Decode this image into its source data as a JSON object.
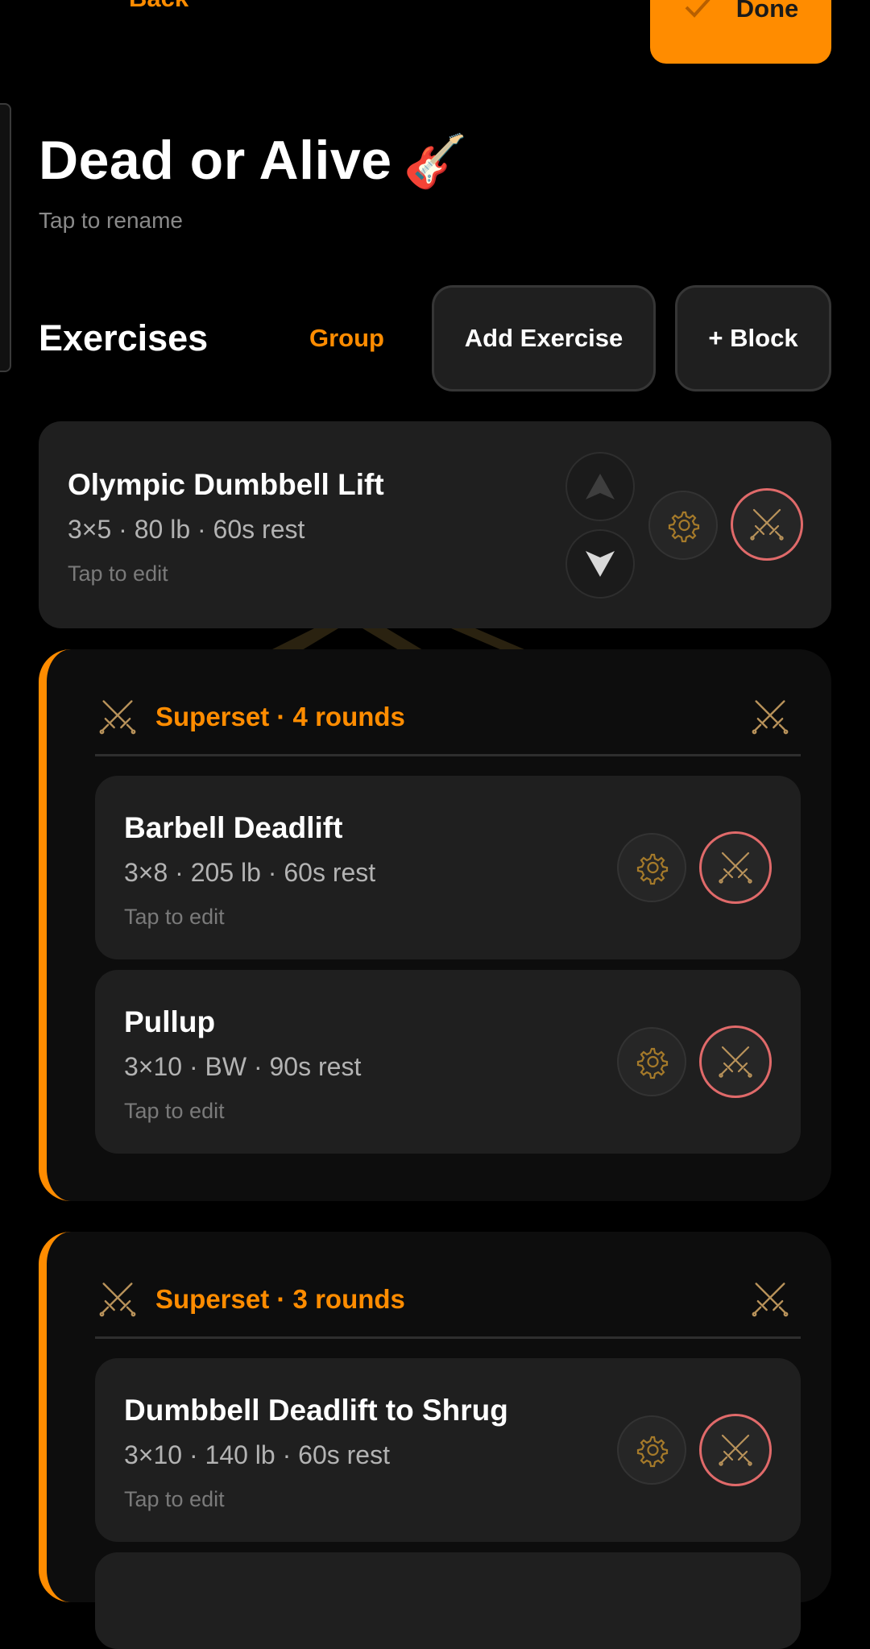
{
  "header": {
    "back_label": "Back",
    "done_label": "Done"
  },
  "workout": {
    "title": "Dead or Alive",
    "title_emoji": "🎸",
    "rename_hint": "Tap to rename"
  },
  "exercises_section": {
    "heading": "Exercises",
    "group_label": "Group",
    "add_exercise_label": "Add Exercise",
    "add_block_label": "+ Block"
  },
  "standalone_exercise": {
    "name": "Olympic Dumbbell Lift",
    "meta": "3×5 · 80 lb · 60s rest",
    "hint": "Tap to edit"
  },
  "supersets": [
    {
      "title": "Superset · 4 rounds",
      "exercises": [
        {
          "name": "Barbell Deadlift",
          "meta": "3×8 · 205 lb · 60s rest",
          "hint": "Tap to edit"
        },
        {
          "name": "Pullup",
          "meta": "3×10 · BW · 90s rest",
          "hint": "Tap to edit"
        }
      ]
    },
    {
      "title": "Superset · 3 rounds",
      "exercises": [
        {
          "name": "Dumbbell Deadlift to Shrug",
          "meta": "3×10 · 140 lb · 60s rest",
          "hint": "Tap to edit"
        }
      ]
    }
  ],
  "icons": {
    "back": "back-arrow-icon",
    "done": "check-icon",
    "move_up": "arrow-up-icon",
    "move_down": "arrow-down-icon",
    "settings": "gear-icon",
    "superset": "crossed-swords-icon"
  },
  "colors": {
    "accent": "#ff8c00",
    "background": "#000000",
    "card": "#1f1f1f",
    "danger_ring": "#e06a6a"
  }
}
